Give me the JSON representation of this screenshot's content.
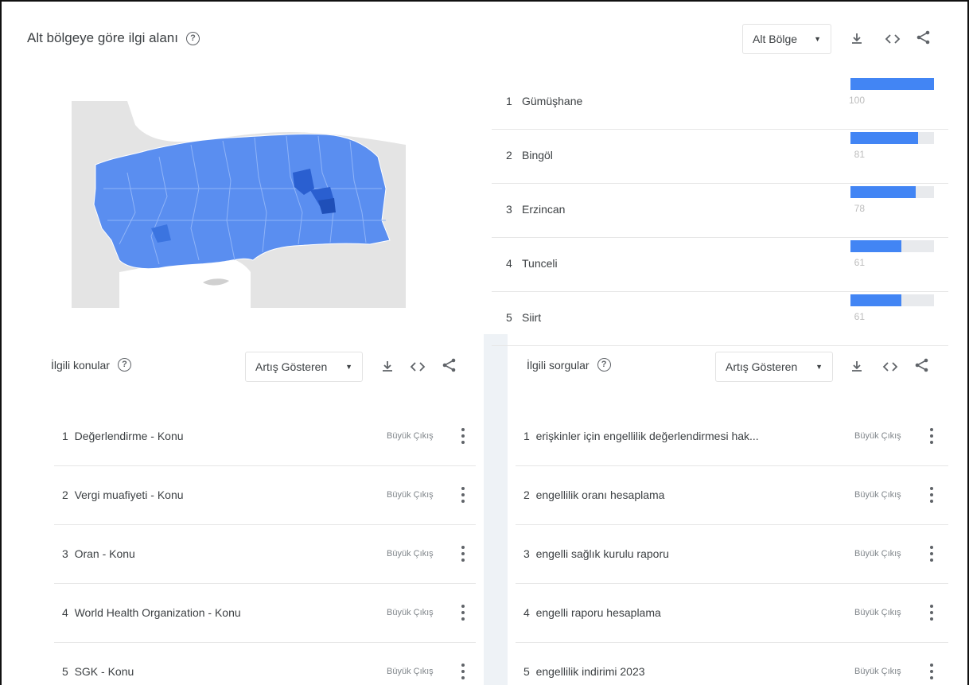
{
  "region_panel": {
    "title": "Alt bölgeye göre ilgi alanı",
    "dropdown_value": "Alt Bölge",
    "ranking": [
      {
        "rank": "1",
        "name": "Gümüşhane",
        "score": "100",
        "value": 100
      },
      {
        "rank": "2",
        "name": "Bingöl",
        "score": "81",
        "value": 81
      },
      {
        "rank": "3",
        "name": "Erzincan",
        "score": "78",
        "value": 78
      },
      {
        "rank": "4",
        "name": "Tunceli",
        "score": "61",
        "value": 61
      },
      {
        "rank": "5",
        "name": "Siirt",
        "score": "61",
        "value": 61
      }
    ],
    "colors": {
      "bar": "#4285f4",
      "map_fill": "#5a8ef0",
      "map_dark": "#2a5fd0",
      "land_bg": "#e4e4e4"
    }
  },
  "topics_panel": {
    "title": "İlgili konular",
    "dropdown_value": "Artış Gösteren",
    "items": [
      {
        "rank": "1",
        "text": "Değerlendirme - Konu",
        "badge": "Büyük Çıkış"
      },
      {
        "rank": "2",
        "text": "Vergi muafiyeti - Konu",
        "badge": "Büyük Çıkış"
      },
      {
        "rank": "3",
        "text": "Oran - Konu",
        "badge": "Büyük Çıkış"
      },
      {
        "rank": "4",
        "text": "World Health Organization - Konu",
        "badge": "Büyük Çıkış"
      },
      {
        "rank": "5",
        "text": "SGK - Konu",
        "badge": "Büyük Çıkış"
      }
    ]
  },
  "queries_panel": {
    "title": "İlgili sorgular",
    "dropdown_value": "Artış Gösteren",
    "items": [
      {
        "rank": "1",
        "text": "erişkinler için engellilik değerlendirmesi hak...",
        "badge": "Büyük Çıkış"
      },
      {
        "rank": "2",
        "text": "engellilik oranı hesaplama",
        "badge": "Büyük Çıkış"
      },
      {
        "rank": "3",
        "text": "engelli sağlık kurulu raporu",
        "badge": "Büyük Çıkış"
      },
      {
        "rank": "4",
        "text": "engelli raporu hesaplama",
        "badge": "Büyük Çıkış"
      },
      {
        "rank": "5",
        "text": "engellilik indirimi 2023",
        "badge": "Büyük Çıkış"
      }
    ]
  },
  "icons": {
    "help": "?",
    "download": "download-icon",
    "embed": "embed-icon",
    "share": "share-icon"
  }
}
